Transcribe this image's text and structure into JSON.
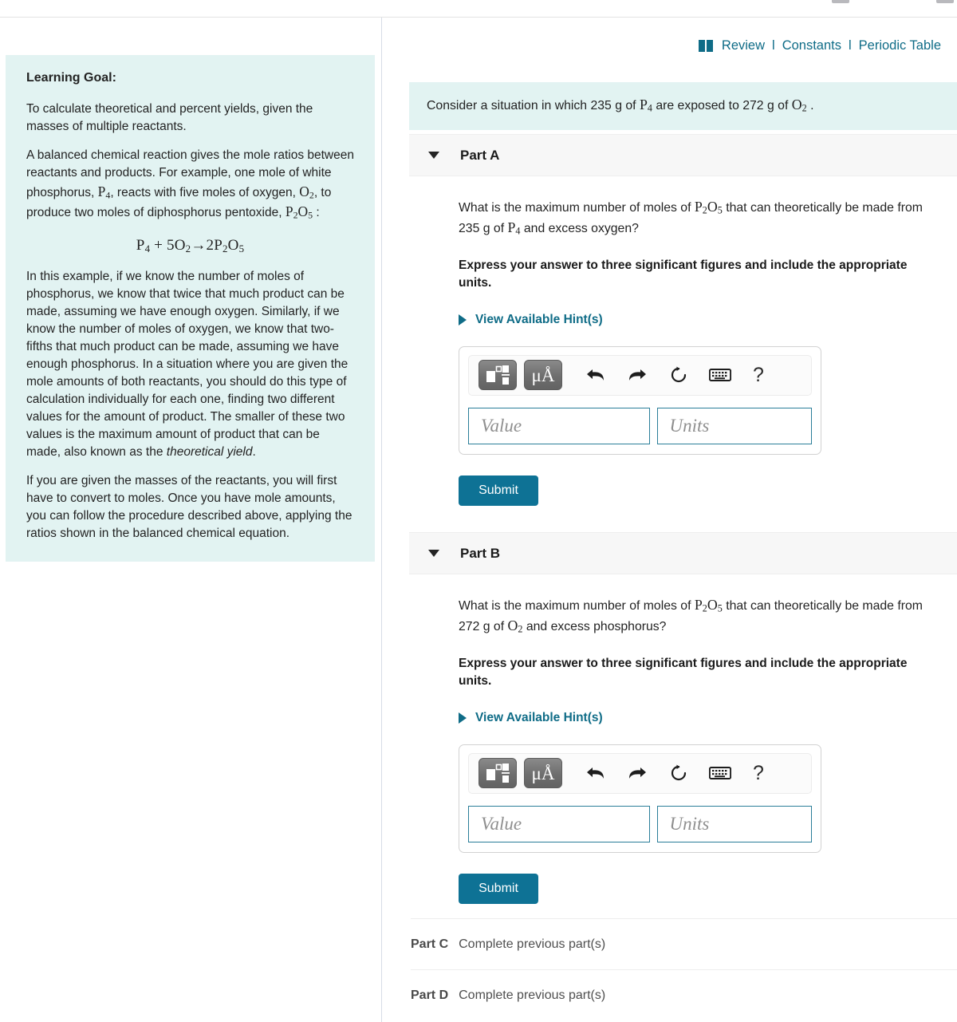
{
  "topbar": {
    "review_label": "Review",
    "constants_label": "Constants",
    "periodic_label": "Periodic Table",
    "separator": "l",
    "link_color": "#0f6c87"
  },
  "left_panel": {
    "goal_title": "Learning Goal:",
    "paragraph_1": "To calculate theoretical and percent yields, given the masses of multiple reactants.",
    "paragraph_2_a": "A balanced chemical reaction gives the mole ratios between reactants and products. For example, one mole of white phosphorus, ",
    "formula_p4": "P4",
    "paragraph_2_b": ", reacts with five moles of oxygen, ",
    "formula_o2": "O2",
    "paragraph_2_c": ", to produce two moles of diphosphorus pentoxide, ",
    "formula_p2o5": "P2O5",
    "paragraph_2_d": " :",
    "equation": "P4 + 5O2→2P2O5",
    "paragraph_3_a": "In this example, if we know the number of moles of phosphorus, we know that twice that much product can be made, assuming we have enough oxygen. Similarly, if we know the number of moles of oxygen, we know that two-fifths that much product can be made, assuming we have enough phosphorus. In a situation where you are given the mole amounts of both reactants, you should do this type of calculation individually for each one, finding two different values for the amount of product. The smaller of these two values is the maximum amount of product that can be made, also known as the ",
    "paragraph_3_italic": "theoretical yield",
    "paragraph_3_b": ".",
    "paragraph_4": "If you are given the masses of the reactants, you will first have to convert to moles. Once you have mole amounts, you can follow the procedure described above, applying the ratios shown in the balanced chemical equation.",
    "background_color": "#e2f3f2"
  },
  "prompt": {
    "text_a": "Consider a situation in which 235 g of ",
    "formula_1": "P4",
    "text_b": " are exposed to 272 g of ",
    "formula_2": "O2",
    "text_c": " .",
    "background_color": "#e2f3f2"
  },
  "parts": [
    {
      "label": "Part A",
      "question_a": "What is the maximum number of moles of ",
      "question_formula": "P2O5",
      "question_b": " that can theoretically be made from 235 g of ",
      "question_formula_2": "P4",
      "question_c": " and excess oxygen?",
      "instruction": "Express your answer to three significant figures and include the appropriate units.",
      "hint_label": "View Available Hint(s)",
      "value_placeholder": "Value",
      "units_placeholder": "Units",
      "submit_label": "Submit"
    },
    {
      "label": "Part B",
      "question_a": "What is the maximum number of moles of ",
      "question_formula": "P2O5",
      "question_b": " that can theoretically be made from 272 g of ",
      "question_formula_2": "O2",
      "question_c": " and excess phosphorus?",
      "instruction": "Express your answer to three significant figures and include the appropriate units.",
      "hint_label": "View Available Hint(s)",
      "value_placeholder": "Value",
      "units_placeholder": "Units",
      "submit_label": "Submit"
    }
  ],
  "toolbar": {
    "template_icon": "math-template-icon",
    "units_label": "μÅ",
    "undo_icon": "undo-arrow-icon",
    "redo_icon": "redo-arrow-icon",
    "reset_icon": "reset-circular-arrow-icon",
    "keyboard_icon": "keyboard-icon",
    "help_label": "?"
  },
  "locked_parts": [
    {
      "label": "Part C",
      "status": "Complete previous part(s)"
    },
    {
      "label": "Part D",
      "status": "Complete previous part(s)"
    }
  ],
  "colors": {
    "accent_teal": "#0e7295",
    "link_teal": "#0f6c87",
    "panel_bg": "#e2f3f2",
    "header_band": "#f7f7f7"
  }
}
